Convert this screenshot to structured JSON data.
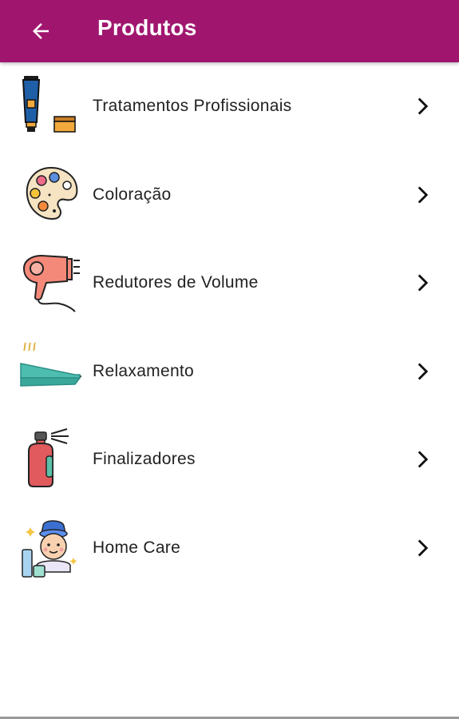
{
  "header": {
    "title": "Produtos",
    "back_icon": "arrow-left-icon",
    "background_color": "#a0166f"
  },
  "items": [
    {
      "label": "Tratamentos Profissionais",
      "icon": "cream-tube-icon"
    },
    {
      "label": "Coloração",
      "icon": "paint-palette-icon"
    },
    {
      "label": "Redutores de Volume",
      "icon": "hair-dryer-icon"
    },
    {
      "label": "Relaxamento",
      "icon": "hair-straightener-icon"
    },
    {
      "label": "Finalizadores",
      "icon": "spray-bottle-icon"
    },
    {
      "label": "Home Care",
      "icon": "home-care-face-icon"
    }
  ]
}
